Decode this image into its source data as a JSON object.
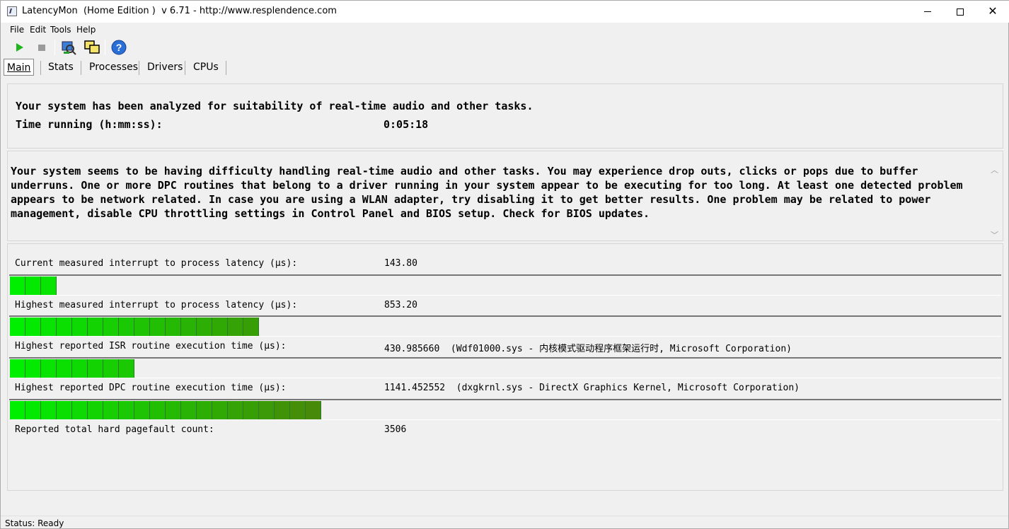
{
  "window": {
    "title": "LatencyMon  (Home Edition )  v 6.71 - http://www.resplendence.com"
  },
  "menu": [
    "File",
    "Edit",
    "Tools",
    "Help"
  ],
  "toolbar": {
    "icons": [
      "play-icon",
      "stop-icon",
      "probe-icon",
      "windows-icon",
      "help-icon"
    ]
  },
  "tabs": [
    "Main",
    "Stats",
    "Processes",
    "Drivers",
    "CPUs"
  ],
  "header": {
    "summary": "Your system has been analyzed for suitability of real-time audio and other tasks.",
    "time_label": "Time running (h:mm:ss):",
    "time_value": "0:05:18"
  },
  "verdict": "Your system seems to be having difficulty handling real-time audio and other tasks. You may experience drop outs, clicks or pops due to buffer underruns. One or more DPC routines that belong to a driver running in your system appear to be executing for too long. At least one detected problem appears to be network related. In case you are using a WLAN adapter, try disabling it to get better results. One problem may be related to power management, disable CPU throttling settings in Control Panel and BIOS setup. Check for BIOS updates.",
  "metrics": [
    {
      "label": "Current measured interrupt to process latency (µs):",
      "value": "143.80",
      "bar_segments": 3
    },
    {
      "label": "Highest measured interrupt to process latency (µs):",
      "value": "853.20",
      "bar_segments": 16
    },
    {
      "label": "Highest reported ISR routine execution time (µs):",
      "value": "430.985660  (Wdf01000.sys - 内核模式驱动程序框架运行时, Microsoft Corporation)",
      "bar_segments": 8
    },
    {
      "label": "Highest reported DPC routine execution time (µs):",
      "value": "1141.452552  (dxgkrnl.sys - DirectX Graphics Kernel, Microsoft Corporation)",
      "bar_segments": 20
    },
    {
      "label": "Reported total hard pagefault count:",
      "value": "3506"
    }
  ],
  "status": "Status: Ready",
  "colors": {
    "bar_start": "#00ee00",
    "bar_end": "#5a6e0a"
  }
}
